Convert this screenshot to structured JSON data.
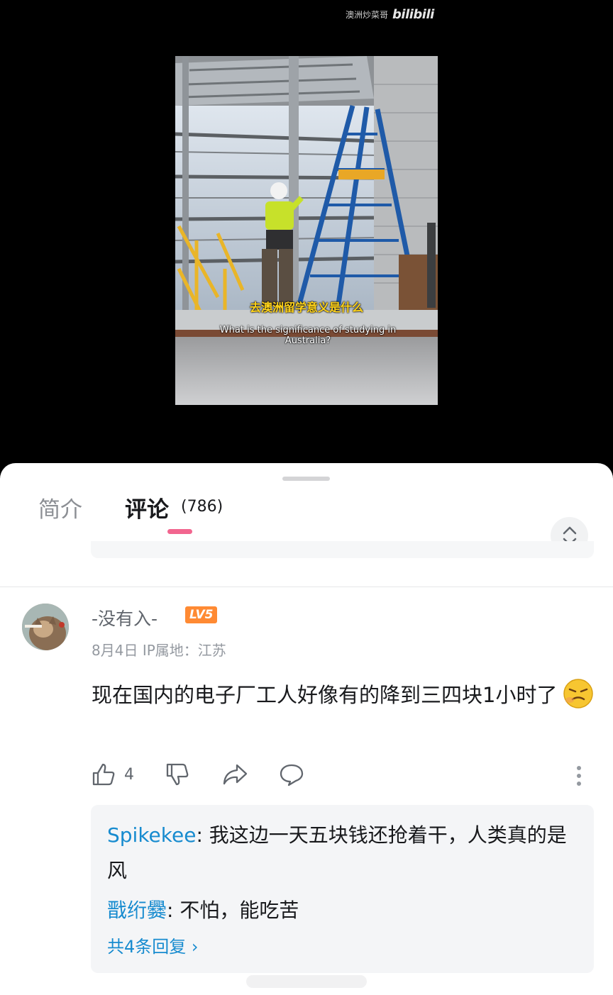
{
  "video": {
    "watermark_uploader": "澳洲炒菜哥",
    "watermark_logo": "bilibili",
    "subtitle_zh": "去澳洲留学意义是什么",
    "subtitle_en": "What is the significance of studying in Australia?"
  },
  "tabs": {
    "intro_label": "简介",
    "comments_label": "评论",
    "comments_count": "(786)"
  },
  "comment": {
    "username": "-没有入-",
    "level": "LV5",
    "date": "8月4日",
    "ip_location": "IP属地：江苏",
    "text": "现在国内的电子厂工人好像有的降到三四块1小时了",
    "emoji_icon": "hmph-emoji-icon",
    "like_count": "4",
    "replies": [
      {
        "user": "Spikekee",
        "separator": ":",
        "text": " 我这边一天五块钱还抢着干，人类真的是风"
      },
      {
        "user": "戬绗爨",
        "separator": ":",
        "text": " 不怕，能吃苦"
      }
    ],
    "replies_more": "共4条回复 ›"
  },
  "colors": {
    "accent_pink": "#f2668f",
    "link_blue": "#178bcf",
    "level_orange": "#ff8a33",
    "subtitle_yellow": "#ffd31a"
  }
}
